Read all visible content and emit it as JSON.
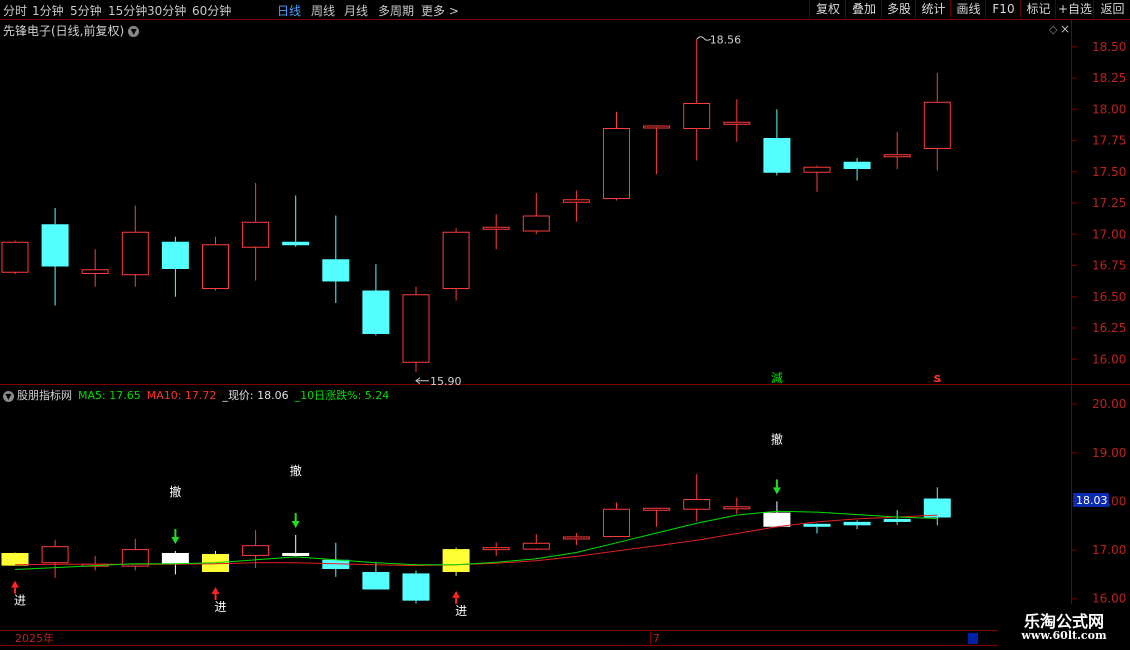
{
  "toolbar": {
    "periods": [
      "分时",
      "1分钟",
      "5分钟",
      "15分钟",
      "30分钟",
      "60分钟",
      "日线",
      "周线",
      "月线",
      "多周期",
      "更多"
    ],
    "active_index": 6,
    "more_arrow": ">",
    "right_buttons": [
      "复权",
      "叠加",
      "多股",
      "统计",
      "画线",
      "F10",
      "标记",
      "+自选",
      "返回"
    ]
  },
  "stock": {
    "title": "先锋电子(日线,前复权)"
  },
  "indicator": {
    "name": "股朋指标网",
    "ma5": "MA5: 17.65",
    "ma10": "MA10: 17.72",
    "price": "_现价: 18.06",
    "change": "_10日涨跌%: 5.24"
  },
  "price_axis": {
    "labels": [
      "18.50",
      "18.25",
      "18.00",
      "17.75",
      "17.50",
      "17.25",
      "17.00",
      "16.75",
      "16.50",
      "16.25",
      "16.00"
    ]
  },
  "ind_axis": {
    "labels": [
      "20.00",
      "19.00",
      "18.00",
      "17.00",
      "16.00"
    ],
    "current": "18.03"
  },
  "annotations": {
    "high": "18.56",
    "low": "15.90"
  },
  "signals": {
    "che": "撤",
    "jin": "进",
    "jian": "減",
    "sell": "s"
  },
  "timeline": {
    "year": "2025年",
    "month": "7"
  },
  "watermark": {
    "line1": "乐淘公式网",
    "line2": "www.60lt.com"
  },
  "colors": {
    "up": "#ff3c3c",
    "down": "#54ffff",
    "ma5": "#00e000",
    "ma10": "#e02020",
    "active": "#4aa3ff",
    "bg": "#000000"
  },
  "chart_data": {
    "type": "candlestick",
    "candles": [
      {
        "o": 16.7,
        "h": 16.95,
        "l": 16.68,
        "c": 16.94
      },
      {
        "o": 17.08,
        "h": 17.21,
        "l": 16.43,
        "c": 16.75
      },
      {
        "o": 16.69,
        "h": 16.88,
        "l": 16.58,
        "c": 16.72
      },
      {
        "o": 16.68,
        "h": 17.23,
        "l": 16.58,
        "c": 17.02
      },
      {
        "o": 16.94,
        "h": 16.98,
        "l": 16.5,
        "c": 16.73
      },
      {
        "o": 16.57,
        "h": 16.98,
        "l": 16.55,
        "c": 16.92
      },
      {
        "o": 16.9,
        "h": 17.41,
        "l": 16.63,
        "c": 17.1
      },
      {
        "o": 16.94,
        "h": 17.31,
        "l": 16.9,
        "c": 16.92
      },
      {
        "o": 16.8,
        "h": 17.15,
        "l": 16.45,
        "c": 16.63
      },
      {
        "o": 16.55,
        "h": 16.76,
        "l": 16.19,
        "c": 16.21
      },
      {
        "o": 15.98,
        "h": 16.58,
        "l": 15.9,
        "c": 16.52
      },
      {
        "o": 16.57,
        "h": 17.05,
        "l": 16.47,
        "c": 17.02
      },
      {
        "o": 17.06,
        "h": 17.16,
        "l": 16.88,
        "c": 17.06
      },
      {
        "o": 17.03,
        "h": 17.33,
        "l": 17.0,
        "c": 17.15
      },
      {
        "o": 17.26,
        "h": 17.35,
        "l": 17.1,
        "c": 17.28
      },
      {
        "o": 17.29,
        "h": 17.98,
        "l": 17.27,
        "c": 17.85
      },
      {
        "o": 17.86,
        "h": 17.86,
        "l": 17.48,
        "c": 17.87
      },
      {
        "o": 17.85,
        "h": 18.56,
        "l": 17.59,
        "c": 18.05
      },
      {
        "o": 17.89,
        "h": 18.08,
        "l": 17.74,
        "c": 17.9
      },
      {
        "o": 17.77,
        "h": 18.0,
        "l": 17.47,
        "c": 17.5
      },
      {
        "o": 17.5,
        "h": 17.55,
        "l": 17.34,
        "c": 17.54
      },
      {
        "o": 17.58,
        "h": 17.61,
        "l": 17.43,
        "c": 17.53
      },
      {
        "o": 17.64,
        "h": 17.82,
        "l": 17.52,
        "c": 17.64
      },
      {
        "o": 17.69,
        "h": 18.29,
        "l": 17.51,
        "c": 18.06
      }
    ],
    "ind_candle_colors": [
      "yellow",
      "up",
      "up",
      "up",
      "white",
      "yellow",
      "up",
      "white",
      "down",
      "down",
      "down",
      "yellow",
      "up",
      "up",
      "up",
      "up",
      "up",
      "up",
      "up",
      "white",
      "down",
      "down",
      "down",
      "down"
    ],
    "ma5": [
      16.6,
      16.64,
      16.68,
      16.72,
      16.72,
      16.74,
      16.8,
      16.86,
      16.8,
      16.74,
      16.7,
      16.7,
      16.75,
      16.82,
      16.95,
      17.15,
      17.35,
      17.55,
      17.72,
      17.8,
      17.78,
      17.73,
      17.68,
      17.65
    ],
    "ma10": [
      16.7,
      16.71,
      16.71,
      16.71,
      16.71,
      16.72,
      16.74,
      16.74,
      16.72,
      16.7,
      16.68,
      16.7,
      16.73,
      16.78,
      16.87,
      16.98,
      17.09,
      17.2,
      17.34,
      17.48,
      17.58,
      17.64,
      17.68,
      17.72
    ],
    "price_range": [
      15.85,
      18.65
    ],
    "ind_range": [
      15.85,
      20.25
    ]
  }
}
